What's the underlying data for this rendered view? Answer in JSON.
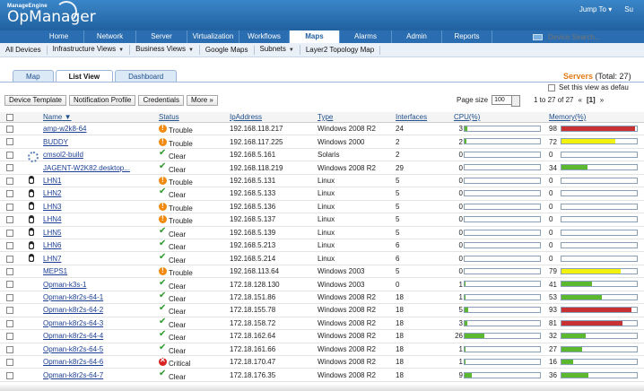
{
  "header": {
    "brand": "ManageEngine",
    "product": "OpManager",
    "jump_to": "Jump To ▾",
    "support": "Su"
  },
  "nav": {
    "tabs": [
      "Home",
      "Network",
      "Server",
      "Virtualization",
      "Workflows",
      "Maps",
      "Alarms",
      "Admin",
      "Reports"
    ],
    "active": "Maps",
    "search_placeholder": "Device Search..."
  },
  "subnav": {
    "items": [
      {
        "label": "All Devices",
        "caret": false
      },
      {
        "label": "Infrastructure Views",
        "caret": true
      },
      {
        "label": "Business Views",
        "caret": true
      },
      {
        "label": "Google Maps",
        "caret": false
      },
      {
        "label": "Subnets",
        "caret": true
      },
      {
        "label": "Layer2 Topology Map",
        "caret": false
      }
    ]
  },
  "view_tabs": {
    "items": [
      "Map",
      "List View",
      "Dashboard"
    ],
    "active": "List View"
  },
  "servers": {
    "title": "Servers",
    "total": "(Total: 27)",
    "set_default": "Set this view as defau"
  },
  "actions": {
    "device_template": "Device Template",
    "notification_profile": "Notification Profile",
    "credentials": "Credentials",
    "more": "More »"
  },
  "paging": {
    "page_size_label": "Page size",
    "page_size": "100",
    "range": "1 to 27 of 27",
    "prev": "«",
    "current": "[1]",
    "next": "»"
  },
  "table": {
    "columns": [
      "Name",
      "Status",
      "IpAddress",
      "Type",
      "Interfaces",
      "CPU(%)",
      "Memory(%)"
    ],
    "colors": {
      "green": "#5cb82e",
      "yellow": "#f2f20c",
      "red": "#c83232"
    },
    "rows": [
      {
        "name": "amp-w2k8-64",
        "os": "windows",
        "status": "Trouble",
        "ip": "192.168.118.217",
        "type": "Windows 2008 R2",
        "interfaces": "24",
        "cpu": 3,
        "mem": 98,
        "mem_color": "red"
      },
      {
        "name": "BUDDY",
        "os": "windows",
        "status": "Trouble",
        "ip": "192.168.117.225",
        "type": "Windows 2000",
        "interfaces": "2",
        "cpu": 2,
        "mem": 72,
        "mem_color": "yellow"
      },
      {
        "name": "cmsol2-build",
        "os": "solaris",
        "status": "Clear",
        "ip": "192.168.5.161",
        "type": "Solaris",
        "interfaces": "2",
        "cpu": 0,
        "mem": 0,
        "mem_color": "green"
      },
      {
        "name": "JAGENT-W2K82.desktop...",
        "os": "windows",
        "status": "Clear",
        "ip": "192.168.118.219",
        "type": "Windows 2008 R2",
        "interfaces": "29",
        "cpu": 0,
        "mem": 34,
        "mem_color": "green"
      },
      {
        "name": "LHN1",
        "os": "linux",
        "status": "Trouble",
        "ip": "192.168.5.131",
        "type": "Linux",
        "interfaces": "5",
        "cpu": 0,
        "mem": 0,
        "mem_color": "green"
      },
      {
        "name": "LHN2",
        "os": "linux",
        "status": "Clear",
        "ip": "192.168.5.133",
        "type": "Linux",
        "interfaces": "5",
        "cpu": 0,
        "mem": 0,
        "mem_color": "green"
      },
      {
        "name": "LHN3",
        "os": "linux",
        "status": "Trouble",
        "ip": "192.168.5.136",
        "type": "Linux",
        "interfaces": "5",
        "cpu": 0,
        "mem": 0,
        "mem_color": "green"
      },
      {
        "name": "LHN4",
        "os": "linux",
        "status": "Trouble",
        "ip": "192.168.5.137",
        "type": "Linux",
        "interfaces": "5",
        "cpu": 0,
        "mem": 0,
        "mem_color": "green"
      },
      {
        "name": "LHN5",
        "os": "linux",
        "status": "Clear",
        "ip": "192.168.5.139",
        "type": "Linux",
        "interfaces": "5",
        "cpu": 0,
        "mem": 0,
        "mem_color": "green"
      },
      {
        "name": "LHN6",
        "os": "linux",
        "status": "Clear",
        "ip": "192.168.5.213",
        "type": "Linux",
        "interfaces": "6",
        "cpu": 0,
        "mem": 0,
        "mem_color": "green"
      },
      {
        "name": "LHN7",
        "os": "linux",
        "status": "Clear",
        "ip": "192.168.5.214",
        "type": "Linux",
        "interfaces": "6",
        "cpu": 0,
        "mem": 0,
        "mem_color": "green"
      },
      {
        "name": "MEPS1",
        "os": "windows",
        "status": "Trouble",
        "ip": "192.168.113.64",
        "type": "Windows 2003",
        "interfaces": "5",
        "cpu": 0,
        "mem": 79,
        "mem_color": "yellow"
      },
      {
        "name": "Opman-k3s-1",
        "os": "windows",
        "status": "Clear",
        "ip": "172.18.128.130",
        "type": "Windows 2003",
        "interfaces": "0",
        "cpu": 1,
        "mem": 41,
        "mem_color": "green"
      },
      {
        "name": "Opman-k8r2s-64-1",
        "os": "windows",
        "status": "Clear",
        "ip": "172.18.151.86",
        "type": "Windows 2008 R2",
        "interfaces": "18",
        "cpu": 1,
        "mem": 53,
        "mem_color": "green"
      },
      {
        "name": "Opman-k8r2s-64-2",
        "os": "windows",
        "status": "Clear",
        "ip": "172.18.155.78",
        "type": "Windows 2008 R2",
        "interfaces": "18",
        "cpu": 5,
        "mem": 93,
        "mem_color": "red"
      },
      {
        "name": "Opman-k8r2s-64-3",
        "os": "windows",
        "status": "Clear",
        "ip": "172.18.158.72",
        "type": "Windows 2008 R2",
        "interfaces": "18",
        "cpu": 3,
        "mem": 81,
        "mem_color": "red"
      },
      {
        "name": "Opman-k8r2s-64-4",
        "os": "windows",
        "status": "Clear",
        "ip": "172.18.162.64",
        "type": "Windows 2008 R2",
        "interfaces": "18",
        "cpu": 26,
        "mem": 32,
        "mem_color": "green"
      },
      {
        "name": "Opman-k8r2s-64-5",
        "os": "windows",
        "status": "Clear",
        "ip": "172.18.161.66",
        "type": "Windows 2008 R2",
        "interfaces": "18",
        "cpu": 1,
        "mem": 27,
        "mem_color": "green"
      },
      {
        "name": "Opman-k8r2s-64-6",
        "os": "windows",
        "status": "Critical",
        "ip": "172.18.170.47",
        "type": "Windows 2008 R2",
        "interfaces": "18",
        "cpu": 1,
        "mem": 16,
        "mem_color": "green"
      },
      {
        "name": "Opman-k8r2s-64-7",
        "os": "windows",
        "status": "Clear",
        "ip": "172.18.176.35",
        "type": "Windows 2008 R2",
        "interfaces": "18",
        "cpu": 9,
        "mem": 36,
        "mem_color": "green"
      }
    ]
  }
}
